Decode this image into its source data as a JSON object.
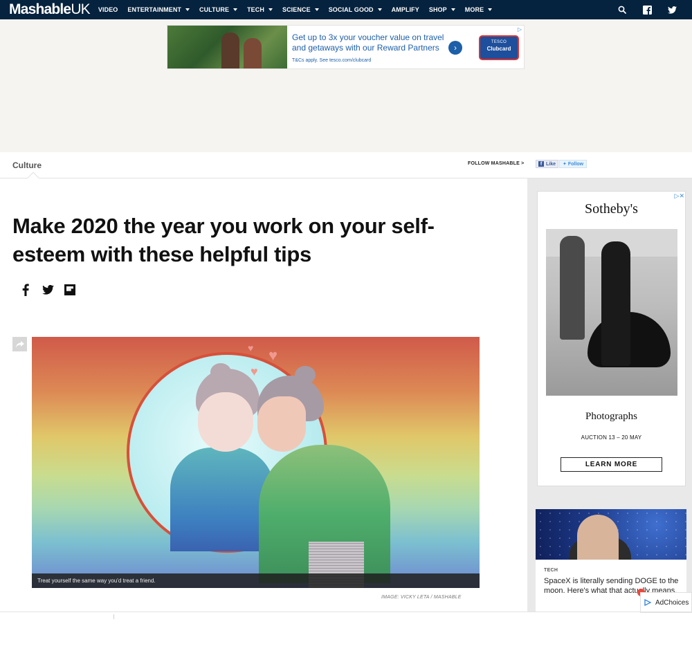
{
  "nav": {
    "logo_main": "Mashable",
    "logo_suffix": "UK",
    "items": [
      {
        "label": "VIDEO",
        "has_dropdown": false
      },
      {
        "label": "ENTERTAINMENT",
        "has_dropdown": true
      },
      {
        "label": "CULTURE",
        "has_dropdown": true
      },
      {
        "label": "TECH",
        "has_dropdown": true
      },
      {
        "label": "SCIENCE",
        "has_dropdown": true
      },
      {
        "label": "SOCIAL GOOD",
        "has_dropdown": true
      },
      {
        "label": "AMPLIFY",
        "has_dropdown": false
      },
      {
        "label": "SHOP",
        "has_dropdown": true
      },
      {
        "label": "MORE",
        "has_dropdown": true
      }
    ],
    "icons": [
      "search-icon",
      "facebook-icon",
      "twitter-icon"
    ]
  },
  "banner_ad": {
    "headline": "Get up to 3x your voucher value on travel and getaways with our Reward Partners",
    "fine_print": "T&Cs apply. See tesco.com/clubcard",
    "badge_top": "TESCO",
    "badge_bottom": "Clubcard"
  },
  "section": {
    "label": "Culture",
    "follow_label": "FOLLOW MASHABLE >",
    "fb_like": "Like",
    "tw_follow": "Follow"
  },
  "article": {
    "headline": "Make 2020 the year you work on your self-esteem with these helpful tips",
    "share_icons": [
      "facebook-icon",
      "twitter-icon",
      "flipboard-icon"
    ],
    "image_caption": "Treat yourself the same way you'd treat a friend.",
    "image_credit": "IMAGE: VICKY LETA / MASHABLE"
  },
  "sidebar_ad": {
    "brand": "Sotheby's",
    "title": "Photographs",
    "subtitle": "AUCTION 13 – 20 MAY",
    "cta": "LEARN MORE"
  },
  "promo": {
    "category": "TECH",
    "title": "SpaceX is literally sending DOGE to the moon. Here's what that actually means."
  },
  "adchoices": {
    "label": "AdChoices"
  },
  "colors": {
    "nav_bg": "#05223e",
    "ad_band_bg": "#f5f4f0",
    "rail_bg": "#e9e9e9",
    "link_blue": "#1d5fa8",
    "facebook_blue": "#3b5998",
    "twitter_blue": "#3a8bd8",
    "hero_caption_bg": "#1e1e1e",
    "adchoices_dot": "#e84a3d"
  }
}
